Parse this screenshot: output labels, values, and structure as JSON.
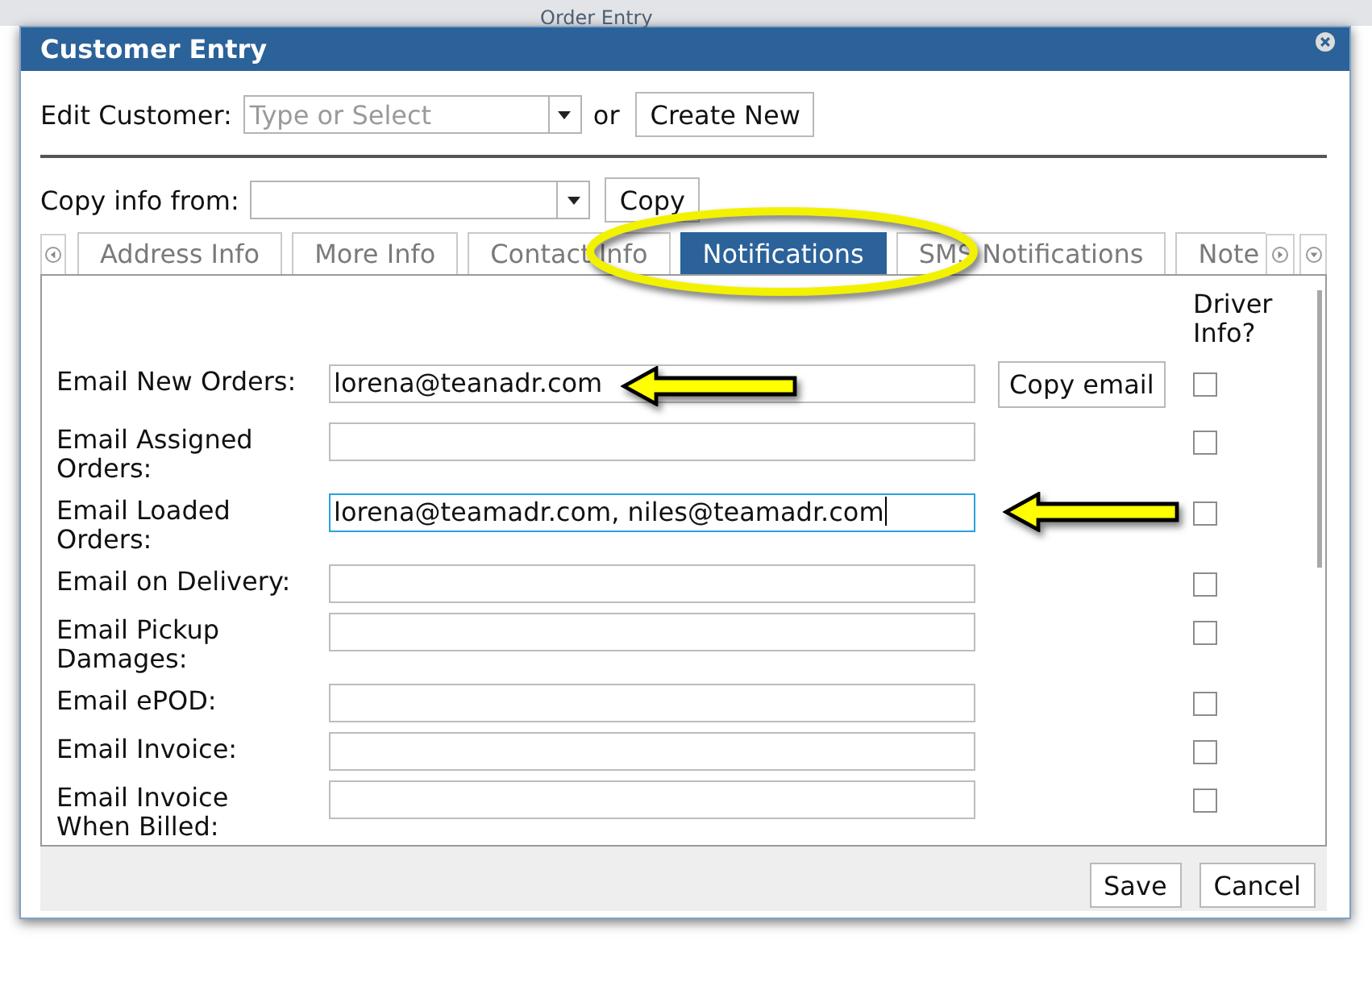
{
  "background": {
    "title": "Order Entry"
  },
  "dialog": {
    "title": "Customer Entry"
  },
  "edit_customer": {
    "label": "Edit Customer:",
    "placeholder": "Type or Select",
    "or_text": "or",
    "create_button": "Create New"
  },
  "copy_info": {
    "label": "Copy info from:",
    "button": "Copy"
  },
  "tabs": [
    {
      "label": "Address Info",
      "selected": false,
      "circled": false
    },
    {
      "label": "More Info",
      "selected": false,
      "circled": false
    },
    {
      "label": "Contact Info",
      "selected": false,
      "circled": false
    },
    {
      "label": "Notifications",
      "selected": true,
      "circled": true
    },
    {
      "label": "SMS Notifications",
      "selected": false,
      "circled": false
    },
    {
      "label": "Note",
      "selected": false,
      "circled": false
    }
  ],
  "notifications": {
    "driver_info_header": "Driver Info?",
    "rows": [
      {
        "label": "Email New Orders:",
        "value": "lorena@teanadr.com",
        "focused": false,
        "driver_info": false,
        "button": "Copy email",
        "arrow": true
      },
      {
        "label": "Email Assigned Orders:",
        "focused": false,
        "driver_info": false,
        "arrow": false
      },
      {
        "label": "Email Loaded Orders:",
        "value": "lorena@teamadr.com, niles@teamadr.com",
        "focused": true,
        "driver_info": false,
        "arrow": true
      },
      {
        "label": "Email on Delivery:",
        "focused": false,
        "driver_info": false,
        "arrow": false
      },
      {
        "label": "Email Pickup Damages:",
        "focused": false,
        "driver_info": false,
        "arrow": false
      },
      {
        "label": "Email ePOD:",
        "focused": false,
        "driver_info": false,
        "arrow": false
      },
      {
        "label": "Email Invoice:",
        "focused": false,
        "driver_info": false,
        "arrow": false
      },
      {
        "label": "Email Invoice When Billed:",
        "focused": false,
        "driver_info": false,
        "arrow": false
      }
    ]
  },
  "footer": {
    "buttons": [
      "Save",
      "Cancel"
    ]
  }
}
